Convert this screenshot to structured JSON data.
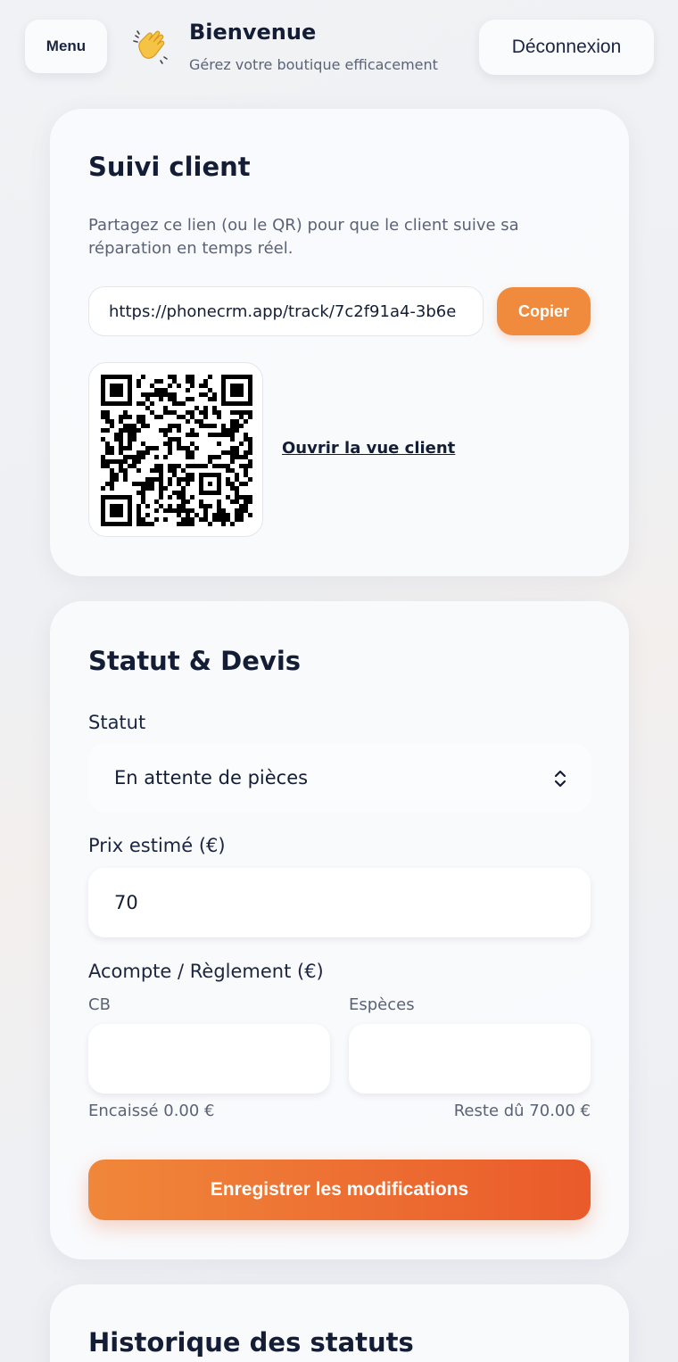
{
  "header": {
    "menu_label": "Menu",
    "title": "Bienvenue",
    "subtitle": "Gérez votre boutique efficacement",
    "logout_label": "Déconnexion",
    "wave_icon": "waving-hand-icon"
  },
  "tracking": {
    "title": "Suivi client",
    "description": "Partagez ce lien (ou le QR) pour que le client suive sa réparation en temps réel.",
    "url": "https://phonecrm.app/track/7c2f91a4-3b6e",
    "copy_label": "Copier",
    "open_link_label": "Ouvrir la vue client",
    "qr_icon": "qr-code-icon"
  },
  "status_card": {
    "title": "Statut & Devis",
    "status_label": "Statut",
    "status_value": "En attente de pièces",
    "price_label": "Prix estimé (€)",
    "price_value": "70",
    "deposit_label": "Acompte / Règlement (€)",
    "cb_label": "CB",
    "cb_value": "",
    "cash_label": "Espèces",
    "cash_value": "",
    "collected_text": "Encaissé 0.00 €",
    "remaining_text": "Reste dû 70.00 €",
    "save_label": "Enregistrer les modifications"
  },
  "history": {
    "title": "Historique des statuts"
  },
  "colors": {
    "accent": "#f08a3c",
    "accent_dark": "#ea5a2b",
    "text_dark": "#141d36",
    "text_muted": "#5a6376"
  }
}
